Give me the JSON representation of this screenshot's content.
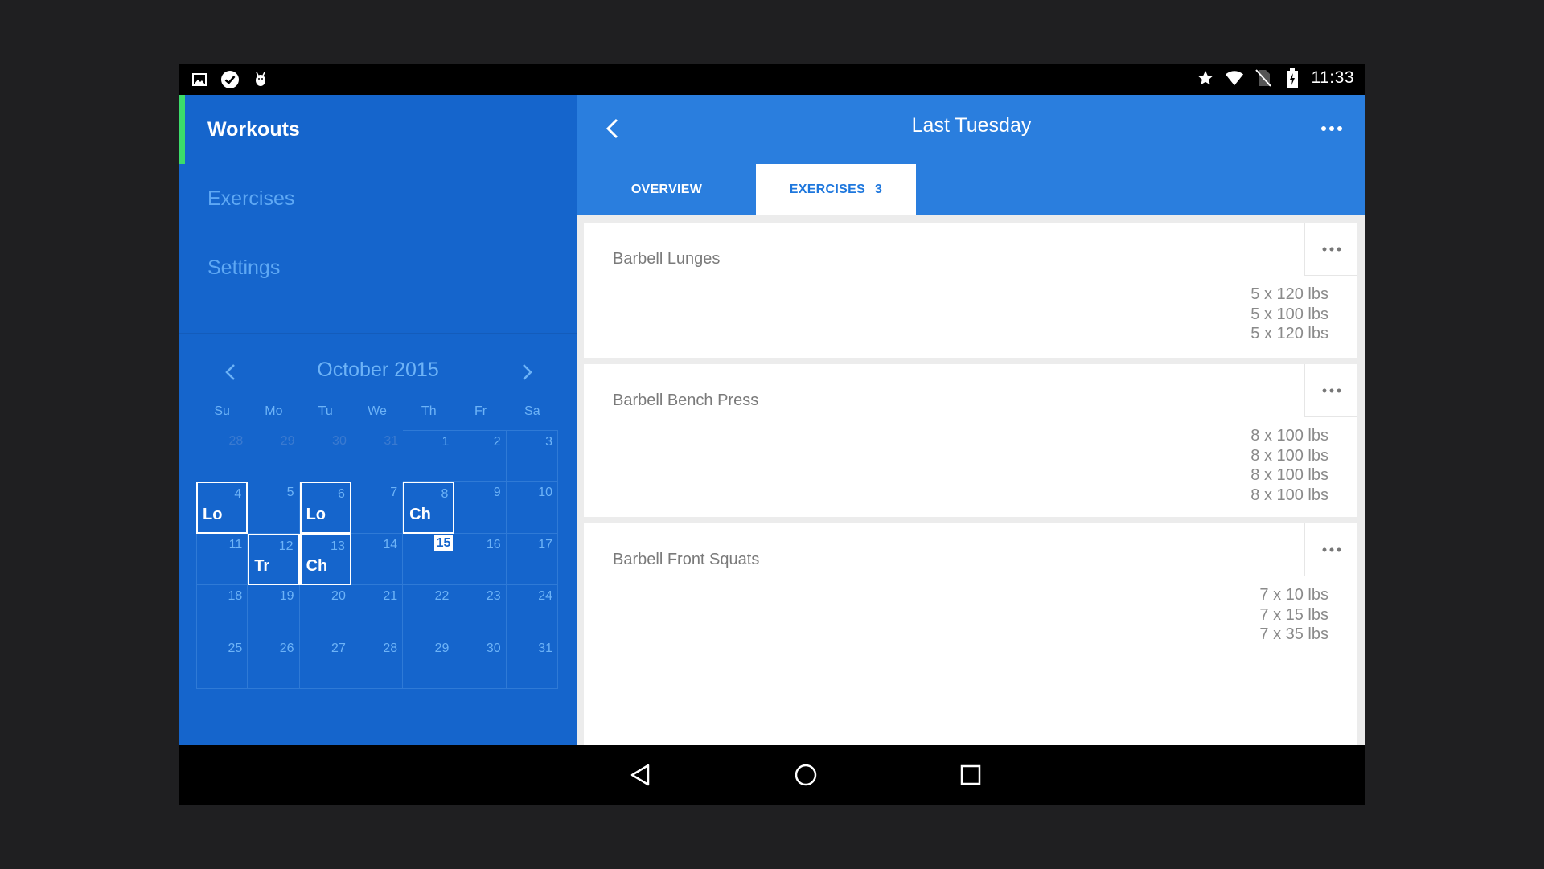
{
  "status_bar": {
    "left_icons": [
      "image-icon",
      "check-circle-icon",
      "android-debug-icon"
    ],
    "right_icons": [
      "star-icon",
      "wifi-icon",
      "no-sim-icon",
      "battery-charging-icon"
    ],
    "time": "11:33"
  },
  "drawer": {
    "items": [
      {
        "label": "Workouts",
        "active": true
      },
      {
        "label": "Exercises",
        "active": false
      },
      {
        "label": "Settings",
        "active": false
      }
    ],
    "calendar": {
      "month_label": "October 2015",
      "weekdays": [
        "Su",
        "Mo",
        "Tu",
        "We",
        "Th",
        "Fr",
        "Sa"
      ],
      "days": [
        {
          "n": "28",
          "muted": true
        },
        {
          "n": "29",
          "muted": true
        },
        {
          "n": "30",
          "muted": true
        },
        {
          "n": "31",
          "muted": true
        },
        {
          "n": "1"
        },
        {
          "n": "2"
        },
        {
          "n": "3"
        },
        {
          "n": "4",
          "tag": "Lo"
        },
        {
          "n": "5"
        },
        {
          "n": "6",
          "tag": "Lo"
        },
        {
          "n": "7"
        },
        {
          "n": "8",
          "tag": "Ch"
        },
        {
          "n": "9"
        },
        {
          "n": "10"
        },
        {
          "n": "11"
        },
        {
          "n": "12",
          "tag": "Tr"
        },
        {
          "n": "13",
          "tag": "Ch"
        },
        {
          "n": "14"
        },
        {
          "n": "15",
          "today": true
        },
        {
          "n": "16"
        },
        {
          "n": "17"
        },
        {
          "n": "18"
        },
        {
          "n": "19"
        },
        {
          "n": "20"
        },
        {
          "n": "21"
        },
        {
          "n": "22"
        },
        {
          "n": "23"
        },
        {
          "n": "24"
        },
        {
          "n": "25"
        },
        {
          "n": "26"
        },
        {
          "n": "27"
        },
        {
          "n": "28"
        },
        {
          "n": "29"
        },
        {
          "n": "30"
        },
        {
          "n": "31"
        }
      ]
    }
  },
  "header": {
    "title": "Last Tuesday",
    "tabs": {
      "overview": "OVERVIEW",
      "exercises": "EXERCISES",
      "exercises_count": "3"
    }
  },
  "exercises": [
    {
      "name": "Barbell Lunges",
      "sets": [
        "5 x 120 lbs",
        "5 x 100 lbs",
        "5 x 120 lbs"
      ]
    },
    {
      "name": "Barbell Bench Press",
      "sets": [
        "8 x 100 lbs",
        "8 x 100 lbs",
        "8 x 100 lbs",
        "8 x 100 lbs"
      ]
    },
    {
      "name": "Barbell Front Squats",
      "sets": [
        "7 x 10 lbs",
        "7 x 15 lbs",
        "7 x 35 lbs"
      ]
    }
  ],
  "nav_bar": [
    "back-triangle-icon",
    "home-circle-icon",
    "recents-square-icon"
  ],
  "colors": {
    "drawer_bg": "#1565cc",
    "appbar_bg": "#2a7ede",
    "active_indicator": "#3cdc6a",
    "accent_text": "#1e77dd"
  }
}
